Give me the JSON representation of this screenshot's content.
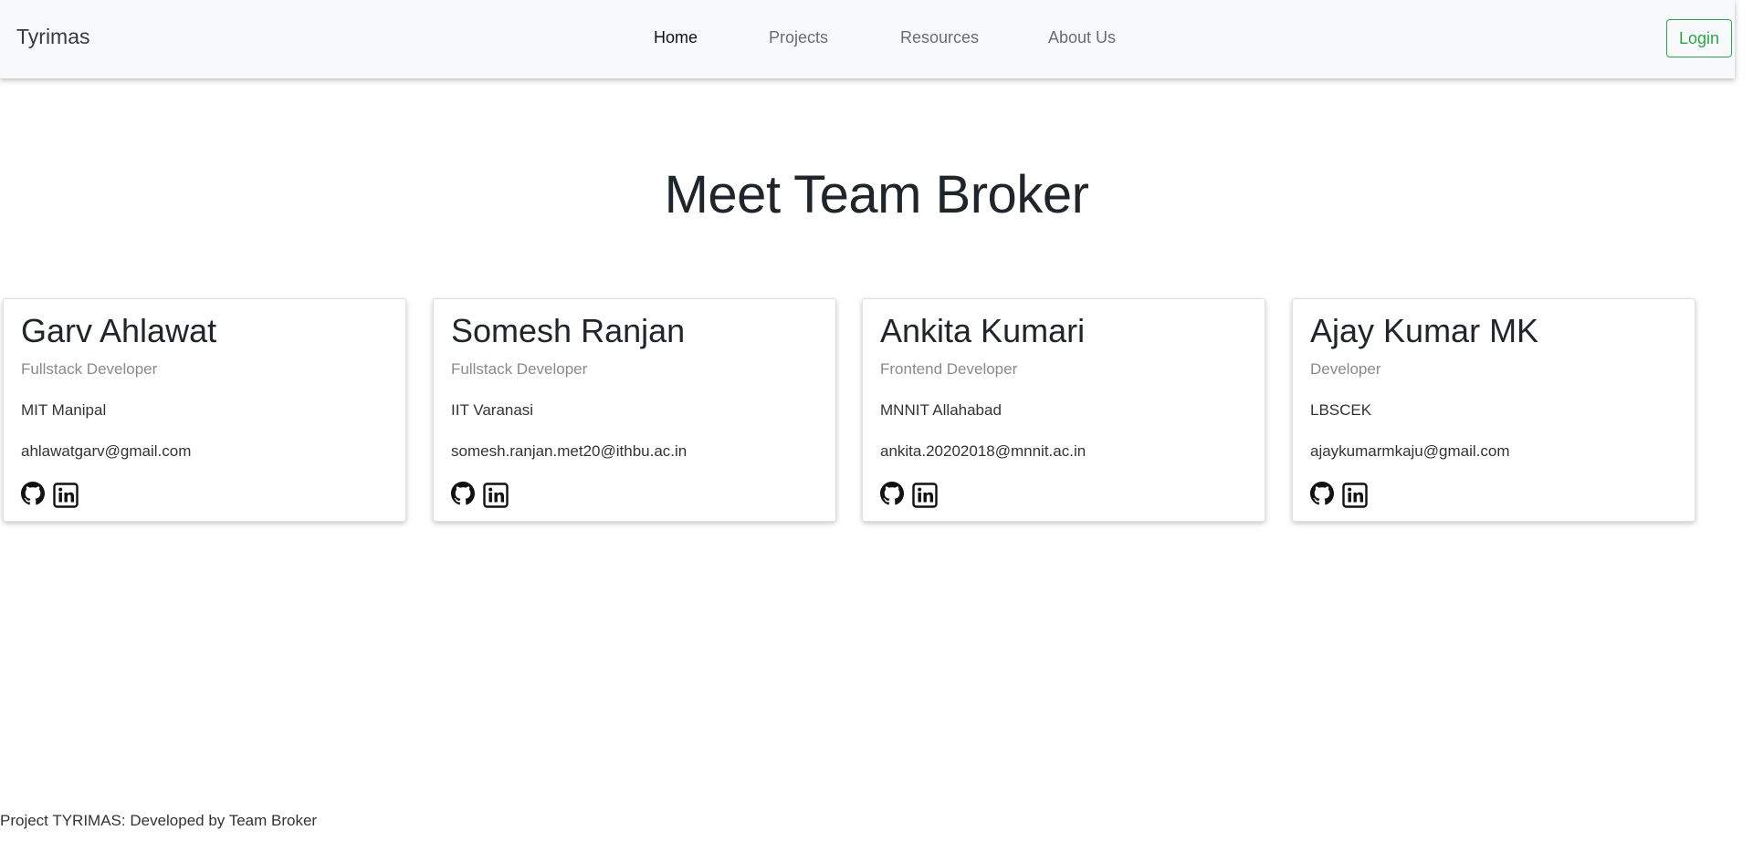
{
  "navbar": {
    "brand": "Tyrimas",
    "links": [
      {
        "label": "Home"
      },
      {
        "label": "Projects"
      },
      {
        "label": "Resources"
      },
      {
        "label": "About Us"
      }
    ],
    "login_label": "Login",
    "login_color": "#28a745"
  },
  "page": {
    "title": "Meet Team Broker"
  },
  "team": [
    {
      "name": "Garv Ahlawat",
      "role": "Fullstack Developer",
      "college": "MIT Manipal",
      "email": "ahlawatgarv@gmail.com",
      "icons": [
        "github-icon",
        "linkedin-icon"
      ]
    },
    {
      "name": "Somesh Ranjan",
      "role": "Fullstack Developer",
      "college": "IIT Varanasi",
      "email": "somesh.ranjan.met20@ithbu.ac.in",
      "icons": [
        "github-icon",
        "linkedin-icon"
      ]
    },
    {
      "name": "Ankita Kumari",
      "role": "Frontend Developer",
      "college": "MNNIT Allahabad",
      "email": "ankita.20202018@mnnit.ac.in",
      "icons": [
        "github-icon",
        "linkedin-icon"
      ]
    },
    {
      "name": "Ajay Kumar MK",
      "role": "Developer",
      "college": "LBSCEK",
      "email": "ajaykumarmkaju@gmail.com",
      "icons": [
        "github-icon",
        "linkedin-icon"
      ]
    }
  ],
  "footer": {
    "text": "Project TYRIMAS: Developed by Team Broker"
  }
}
